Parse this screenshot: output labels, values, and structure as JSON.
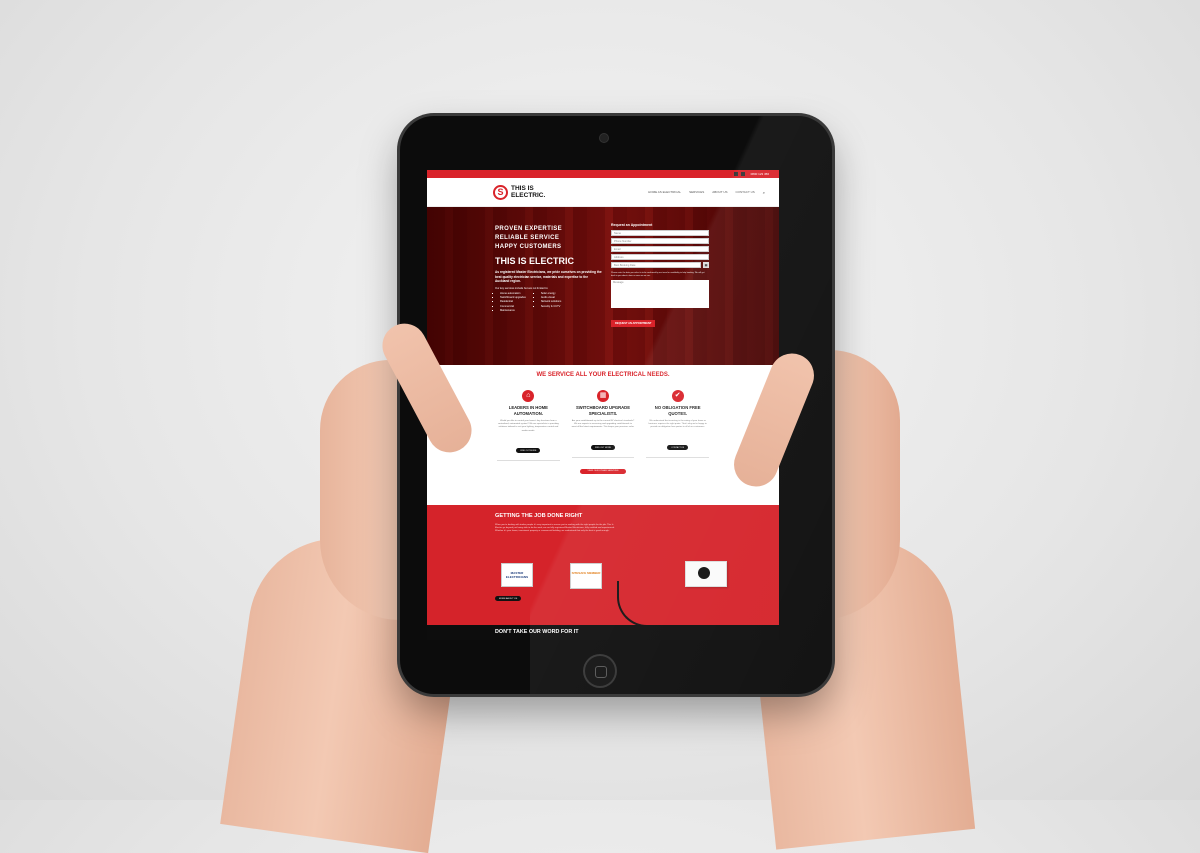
{
  "site": {
    "topbar_phone": "0800 123 456",
    "logo_mark": "S",
    "logo_text": "THIS IS ELECTRIC.",
    "nav": [
      "HOME AS ELECTRICAL",
      "SERVICES",
      "ABOUT US",
      "CONTACT US"
    ],
    "search_glyph": "⌕"
  },
  "hero": {
    "taglines": [
      "PROVEN EXPERTISE",
      "RELIABLE SERVICE",
      "HAPPY CUSTOMERS"
    ],
    "title": "THIS IS ELECTRIC",
    "description": "As registered Master Electricians, we pride ourselves on providing the best quality electrician service, materials and expertise to the Auckland region.",
    "services_intro": "Our key services include but are not limited to:",
    "services_left": [
      "Home automation",
      "Switchboard upgrades",
      "Residential",
      "Commercial",
      "Maintenance"
    ],
    "services_right": [
      "Solar energy",
      "Audio visual",
      "Network solutions",
      "Security & CCTV"
    ]
  },
  "form": {
    "title": "Request an Appointment",
    "name_placeholder": "Name",
    "phone_placeholder": "Phone Number",
    "email_placeholder": "Email",
    "address_placeholder": "Address",
    "date_placeholder": "Best Booking Date",
    "note": "Please note: the date you select is to be confirmed by our team for availability to help booking. We will get back to you about a time as soon as we can.",
    "message_placeholder": "Message",
    "submit_label": "REQUEST AN APPOINTMENT"
  },
  "services_section": {
    "title": "WE SERVICE ALL YOUR ELECTRICAL NEEDS.",
    "features": [
      {
        "icon": "⌂",
        "title": "LEADERS IN HOME AUTOMATION.",
        "text": "Would you like to control your home's key functions from a centralised, automated system? We are specialists in providing solutions tailored to suit your lighting, temperature control and media needs.",
        "button": "FIND OUT MORE"
      },
      {
        "icon": "▦",
        "title": "SWITCHBOARD UPGRADE SPECIALISTS.",
        "text": "Are your switchboards up to the current NZ electrical standards? We are experts in assessing and upgrading switchboards to meet all the latest requirements. This keeps your premises safer.",
        "button": "FIND OUT MORE"
      },
      {
        "icon": "✔",
        "title": "NO OBLIGATION FREE QUOTES.",
        "text": "We understand that investing in the wiring of your home or business requires the right quote. That's why we're happy to provide no obligation free quotes to all of our customers.",
        "button": "CONTACT US"
      }
    ],
    "view_all_label": "VIEW OUR OTHER SERVICES"
  },
  "red_section": {
    "title": "GETTING THE JOB DONE RIGHT",
    "text": "When you're dealing with trades people it's very important to ensure you're working with the right people for the job. This Is Electric go beyond just being able to do the work; we are fully registered Master Electricians, fully certified and experienced. Whether it's your home, investment property or commercial building, we understand that only the best is good enough.",
    "badge_master": "MASTER ELECTRICIANS",
    "badge_master_top": "Member",
    "badge_sitesafe": "SITESAFE MEMBER",
    "about_button": "MORE ABOUT US"
  },
  "dark_section": {
    "title": "DON'T TAKE OUR WORD FOR IT"
  }
}
